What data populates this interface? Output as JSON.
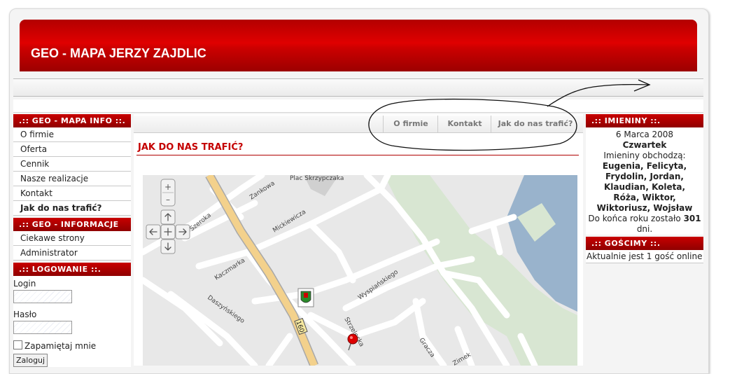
{
  "site": {
    "title": "GEO - MAPA JERZY ZAJDLIC"
  },
  "left": {
    "menu_title": ".:: GEO - MAPA INFO ::.",
    "menu": [
      {
        "label": "O firmie"
      },
      {
        "label": "Oferta"
      },
      {
        "label": "Cennik"
      },
      {
        "label": "Nasze realizacje"
      },
      {
        "label": "Kontakt"
      },
      {
        "label": "Jak do nas trafić?",
        "active": true
      }
    ],
    "info_title": ".:: GEO - INFORMACJE ::.",
    "info": [
      {
        "label": "Ciekawe strony"
      },
      {
        "label": "Administrator"
      }
    ],
    "login_title": ".:: LOGOWANIE ::.",
    "login_label": "Login",
    "password_label": "Hasło",
    "remember_label": "Zapamiętaj mnie",
    "submit_label": "Zaloguj"
  },
  "topmenu": [
    "O firmie",
    "Kontakt",
    "Jak do nas trafić?"
  ],
  "page_title": "JAK DO NAS TRAFIĆ?",
  "right": {
    "names_title": ".:: IMIENINY ::.",
    "date": "6 Marca 2008",
    "weekday": "Czwartek",
    "celebrate_label": "Imieniny obchodzą:",
    "names": [
      "Eugenia, Felicyta,",
      "Frydolin, Jordan,",
      "Klaudian, Koleta,",
      "Róża, Wiktor,",
      "Wiktoriusz, Wojsław"
    ],
    "year_end_prefix": "Do końca roku zostało",
    "year_end_days": "301",
    "year_end_suffix": "dni.",
    "guests_title": ".:: GOŚCIMY ::.",
    "guests_text": "Aktualnie jest 1 gość online"
  },
  "map": {
    "streets": [
      "Plac Skrzypczaka",
      "Zankowa",
      "Szeroka",
      "Mickiewicza",
      "Kaczmarka",
      "Daszyńskiego",
      "Wyspiańskiego",
      "Strzelecka",
      "Gracza",
      "Zimek"
    ],
    "road_number": "160",
    "zoom_in": "+",
    "zoom_out": "–"
  },
  "colors": {
    "accent": "#c40000",
    "banner": "#cc0000"
  }
}
